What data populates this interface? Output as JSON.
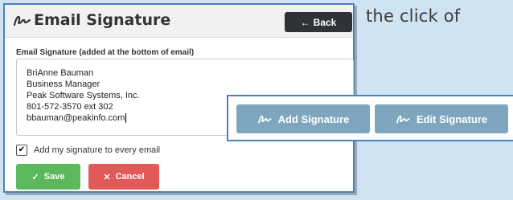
{
  "background_text": "the click of",
  "panel": {
    "title": "Email Signature",
    "back_label": "Back",
    "field_label": "Email Signature (added at the bottom of email)",
    "signature_lines": [
      "BriAnne Bauman",
      "Business Manager",
      "Peak Software Systems, Inc.",
      "801-572-3570 ext 302",
      "bbauman@peakinfo.com"
    ],
    "checkbox_label": "Add my signature to every email",
    "checkbox_checked": true,
    "save_label": "Save",
    "cancel_label": "Cancel"
  },
  "popup": {
    "add_label": "Add Signature",
    "edit_label": "Edit Signature"
  },
  "colors": {
    "save": "#5cb85c",
    "cancel": "#e05a5a",
    "back": "#2f3237",
    "popup_button": "#7fa6bf",
    "border": "#4f7fc0"
  }
}
